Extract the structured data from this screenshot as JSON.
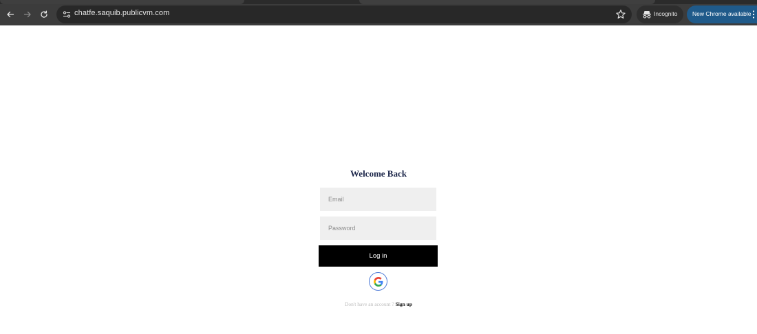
{
  "browser": {
    "url": "chatfe.saquib.publicvm.com",
    "incognito_label": "Incognito",
    "update_label": "New Chrome available"
  },
  "login": {
    "title": "Welcome Back",
    "email_placeholder": "Email",
    "password_placeholder": "Password",
    "login_label": "Log in",
    "google_icon": "google-logo",
    "signup_prompt": "Don't have an account ?",
    "signup_link": "Sign up"
  },
  "colors": {
    "toolbar_bg": "#3c3c3c",
    "omnibox_bg": "#282828",
    "update_chip": "#1f5a8a",
    "title_color": "#1a2448",
    "field_bg": "#efefef",
    "button_bg": "#000000",
    "google_ring": "#4a78d6"
  }
}
